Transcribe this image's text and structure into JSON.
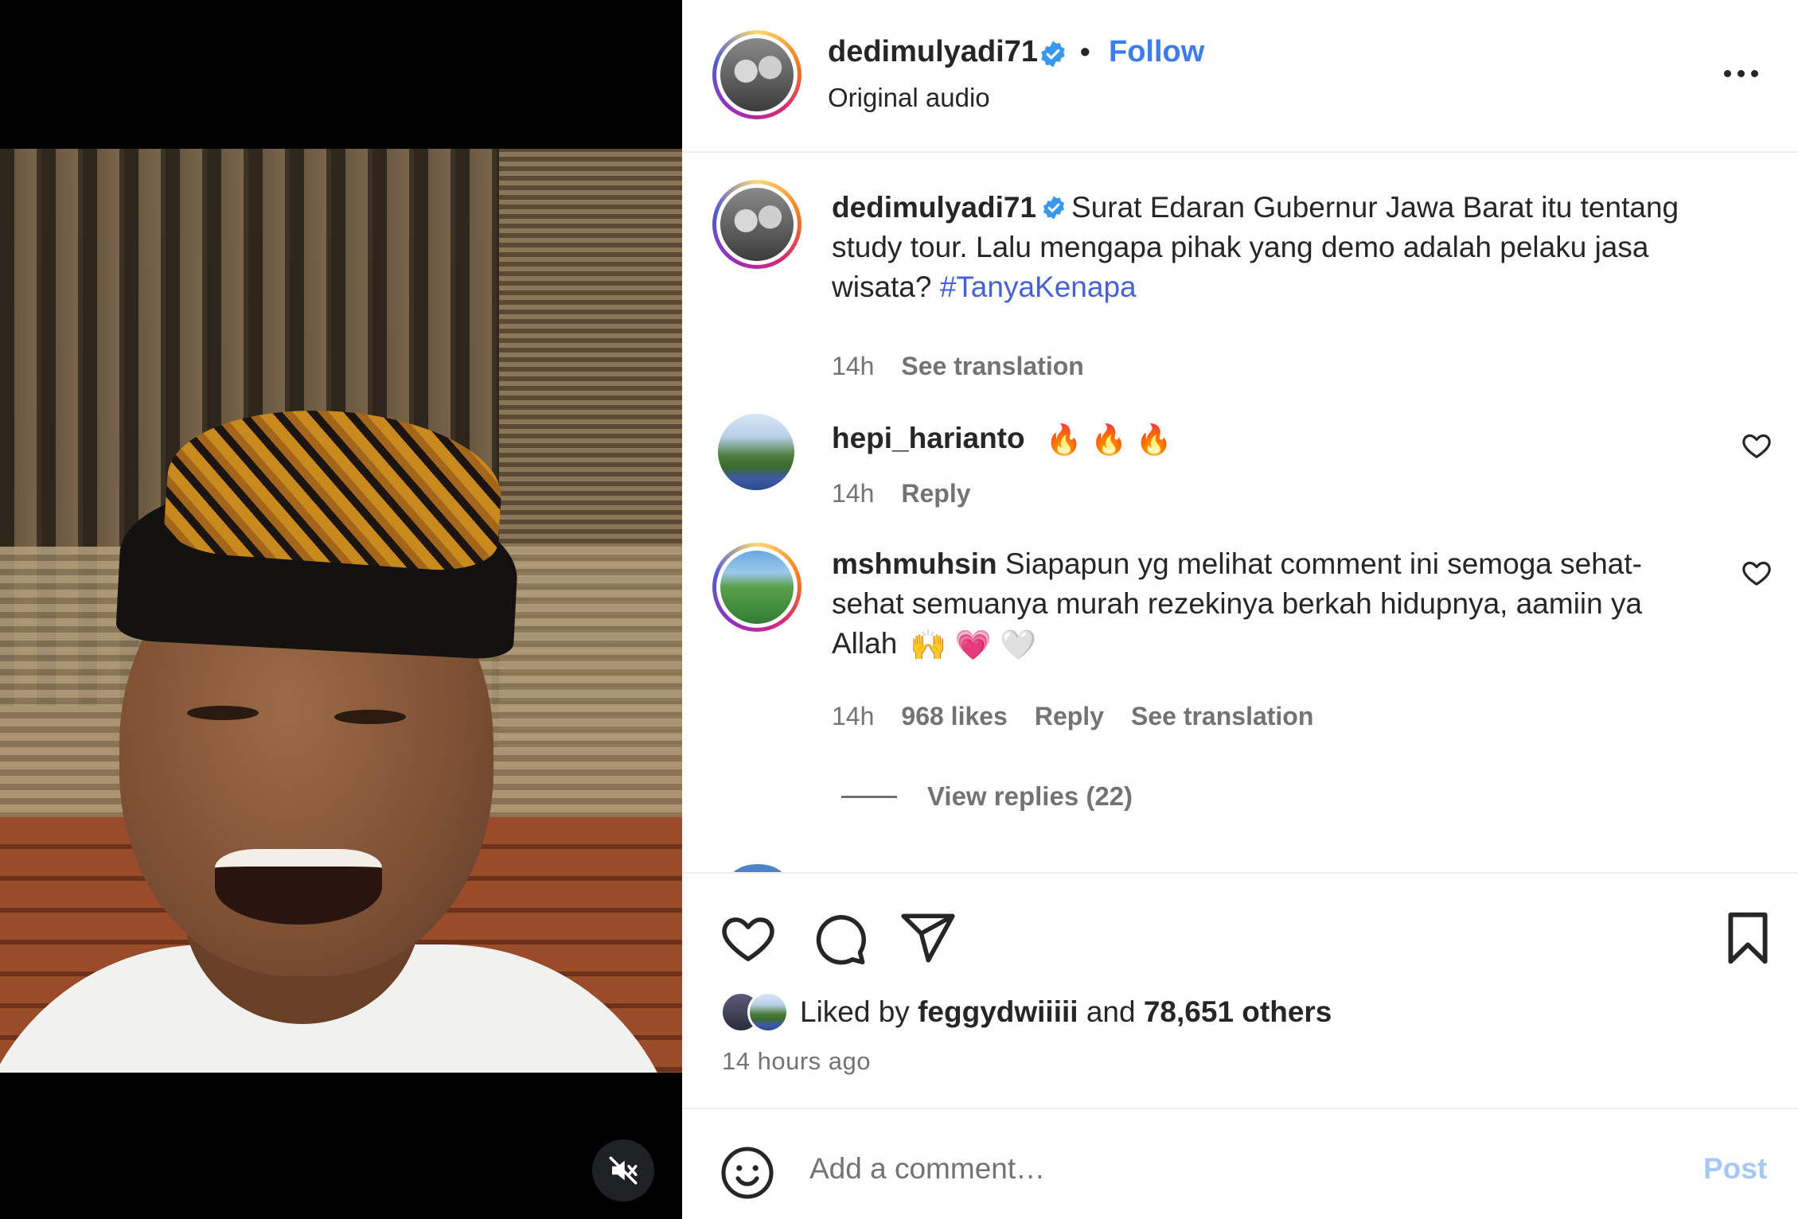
{
  "post": {
    "username": "dedimulyadi71",
    "follow_label": "Follow",
    "audio_label": "Original audio",
    "more_icon": "more-horizontal-icon"
  },
  "caption": {
    "username": "dedimulyadi71",
    "text": "Surat Edaran Gubernur Jawa Barat itu tentang study tour. Lalu mengapa pihak yang demo adalah pelaku jasa wisata?",
    "hashtag": "#TanyaKenapa",
    "time": "14h",
    "translate_label": "See translation"
  },
  "comments": [
    {
      "username": "hepi_harianto",
      "text": "",
      "emoji": "🔥 🔥 🔥",
      "time": "14h",
      "reply_label": "Reply"
    },
    {
      "username": "mshmuhsin",
      "text": "Siapapun yg melihat comment ini semoga sehat-sehat semuanya murah rezekinya berkah hidupnya, aamiin ya Allah",
      "emoji": "🙌 💗 🤍",
      "time": "14h",
      "likes": "968 likes",
      "reply_label": "Reply",
      "translate_label": "See translation",
      "view_replies": "View replies (22)"
    }
  ],
  "likes": {
    "prefix": "Liked by",
    "user": "feggydwiiiii",
    "conj": "and",
    "others": "78,651 others"
  },
  "time_ago": "14 hours ago",
  "composer": {
    "placeholder": "Add a comment…",
    "post_label": "Post"
  },
  "colors": {
    "accent": "#0095f6",
    "text": "#262626",
    "muted": "#737373",
    "verified": "#3897f0"
  }
}
